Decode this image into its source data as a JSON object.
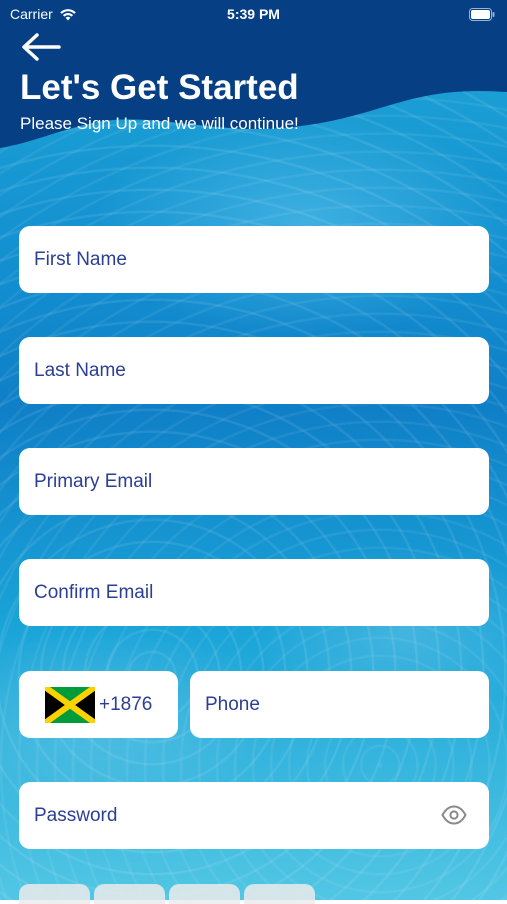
{
  "status_bar": {
    "carrier": "Carrier",
    "time": "5:39 PM"
  },
  "header": {
    "title": "Let's Get Started",
    "subtitle": "Please Sign Up and we will continue!"
  },
  "form": {
    "first_name_placeholder": "First Name",
    "last_name_placeholder": "Last Name",
    "primary_email_placeholder": "Primary Email",
    "confirm_email_placeholder": "Confirm Email",
    "country_code": "+1876",
    "phone_placeholder": "Phone",
    "password_placeholder": "Password"
  },
  "icons": {
    "back": "back-arrow-icon",
    "wifi": "wifi-icon",
    "battery": "battery-icon",
    "flag": "jamaica-flag-icon",
    "eye": "eye-icon"
  },
  "colors": {
    "header_dark": "#063f83",
    "placeholder_text": "#2b3f94",
    "field_bg": "#ffffff"
  }
}
